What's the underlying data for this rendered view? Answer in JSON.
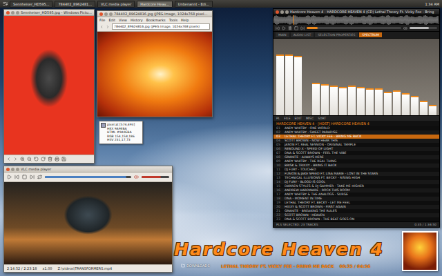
{
  "taskbar": {
    "tasks": [
      {
        "label": "Sennheiser_HD595...",
        "selected": false
      },
      {
        "label": "784402_8962481...",
        "selected": false
      },
      {
        "label": "VLC media player",
        "selected": false
      },
      {
        "label": "Hardcore Heav...",
        "selected": true
      },
      {
        "label": "Unbenannt - Edi...",
        "selected": false
      }
    ],
    "clock": "1:34 AM"
  },
  "image_viewer": {
    "title": "Sennheiser_HD595.jpg - Windows Pictu..."
  },
  "browser": {
    "title": "784402_89624816.jpg (JPEG Image, 1024x768 pixel...",
    "menu": [
      "File",
      "Edit",
      "View",
      "History",
      "Bookmarks",
      "Tools",
      "Help"
    ],
    "url": "784402_89624816.jpg (JPEG Image, 1024x768 pixels)"
  },
  "color_picker": {
    "lines": [
      "pixel at [574,493]",
      "HEX 9A9EBA",
      "HTML #9A9EBA",
      "RGB 154,158,186",
      "HSV 231,17,73"
    ],
    "swatch": "#9a9eba"
  },
  "music_player": {
    "title": "Hardcore Heaven 4 - HARDCORE HEAVEN 4 (CD) Lethal Theory Ft. Vicky Fee - Bring",
    "volume": 0.7,
    "position": 0.12,
    "tabs": [
      {
        "label": "MAIN",
        "selected": false
      },
      {
        "label": "AUDIO LIST",
        "selected": false
      },
      {
        "label": "SELECTION PROPERTIES",
        "selected": false
      },
      {
        "label": "SPECTRUM",
        "selected": true
      }
    ],
    "spectrum": [
      82,
      82,
      80,
      0,
      44,
      42,
      40,
      38,
      40,
      38,
      36,
      36,
      32,
      34,
      30,
      26,
      20,
      14
    ],
    "tools": [
      "PL",
      "FILE",
      "EDIT",
      "MISC",
      "SORT"
    ],
    "playlist_title": "HARDCORE HEAVEN 4 · [HOST] HARDCORE HEAVEN 4",
    "tracks": [
      {
        "number": "01",
        "label": "ANDY WHITBY - ONE WORLD",
        "selected": false
      },
      {
        "number": "02",
        "label": "ANDY WHITBY - SWEET PARADISE",
        "selected": false
      },
      {
        "number": "03",
        "label": "LETHAL THEORY FT. VICKY FEE - BRING ME BACK",
        "selected": true
      },
      {
        "number": "04",
        "label": "SCOTT BROWN - NOW HEAR THIS",
        "selected": false
      },
      {
        "number": "05",
        "label": "JASON FT. REAL SESSION - ORIGINAL TEMPLE",
        "selected": false
      },
      {
        "number": "06",
        "label": "REBOUND X - SPEED OF LIGHT",
        "selected": false
      },
      {
        "number": "07",
        "label": "DNA & SCOTT BROWN - FEEL THE VIBE",
        "selected": false
      },
      {
        "number": "08",
        "label": "GRANITE - ALWAYS HERE",
        "selected": false
      },
      {
        "number": "09",
        "label": "ANDY WHITBY - THE REAL THING",
        "selected": false
      },
      {
        "number": "10",
        "label": "BRISK & TRIXXY - BRING IT BACK",
        "selected": false
      },
      {
        "number": "11",
        "label": "DJ FURY - TOUCHED",
        "selected": false
      },
      {
        "number": "12",
        "label": "FUSION & JAKE SPEED FT. LISA MARIE - LOST IN THE STARS",
        "selected": false
      },
      {
        "number": "13",
        "label": "TECHNICAL ILLUSIONS FT. BECKY - RISING HIGH",
        "selected": false
      },
      {
        "number": "14",
        "label": "DJ FURY - BLOOD IS COOL",
        "selected": false
      },
      {
        "number": "15",
        "label": "DARREN STYLES & DJ GAMMER - TAKE ME HIGHER",
        "selected": false
      },
      {
        "number": "16",
        "label": "ANDREW HARDWARE - ROCK THIS ROOM",
        "selected": false
      },
      {
        "number": "17",
        "label": "ANDY WHITBY & THE ANALOGS - SURGE",
        "selected": false
      },
      {
        "number": "18",
        "label": "DNA - MOMENT IN TIME",
        "selected": false
      },
      {
        "number": "19",
        "label": "LETHAL THEORY FT. BECKY - LET ME FEEL",
        "selected": false
      },
      {
        "number": "20",
        "label": "HIXXY & SCOTT BROWN - FIRST AGAIN",
        "selected": false
      },
      {
        "number": "21",
        "label": "GRANITE - BREAKING THE RULES",
        "selected": false
      },
      {
        "number": "22",
        "label": "SCOTT BROWN - HEAVEN",
        "selected": false
      },
      {
        "number": "23",
        "label": "DNA & SCOTT BROWN - THE BEAT GOES ON",
        "selected": false
      }
    ],
    "status": "PLS SELECTED: 23 TRACKS",
    "total": "0:35 / 1:34:50"
  },
  "vlc": {
    "title": "VLC media player",
    "progress": 0.94,
    "volume": 0.7,
    "time": "2:14:52 / 2:23:18",
    "speed": "x1.00",
    "file": "Z:\\videos\\TRANSFORMERS.mp4"
  },
  "desktop": {
    "banner": "Hardcore Heaven 4",
    "now_playing": "LETHAL THEORY FT. VICKY FEE - BRING ME BACK",
    "time": "00:35 / 04:56",
    "icons": [
      {
        "label": "DOWNLOADS"
      }
    ]
  }
}
